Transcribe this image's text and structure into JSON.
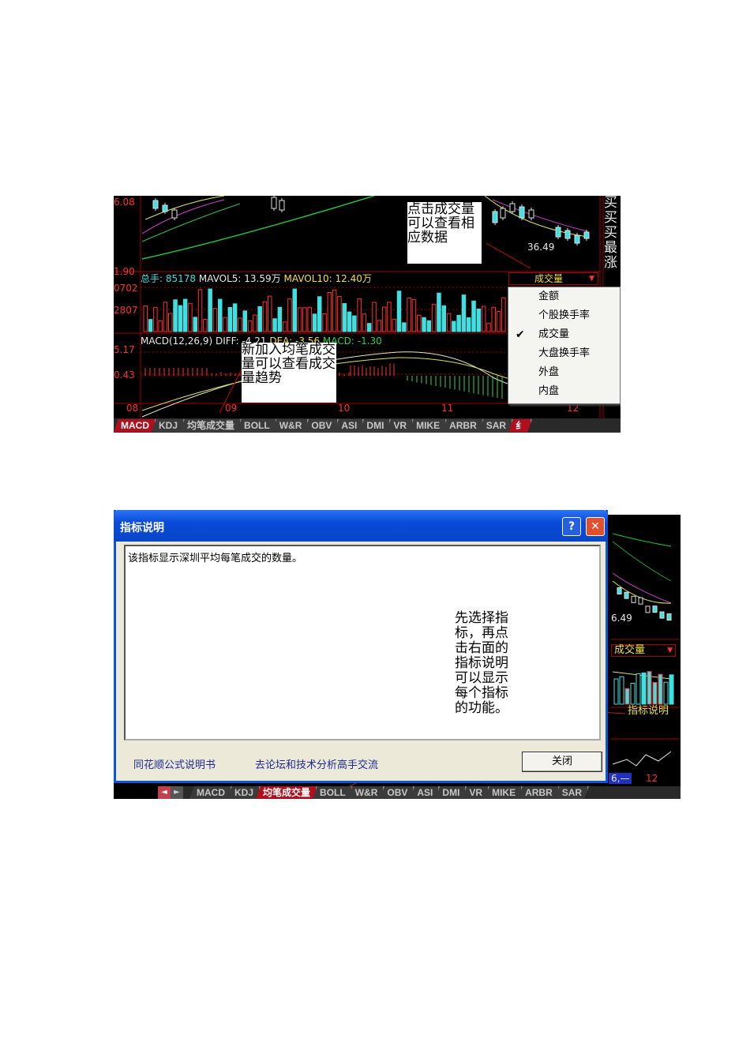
{
  "shot1": {
    "price_top_left": "6.08",
    "price_mid_left": "1.90",
    "vol_axis_1": "0702",
    "vol_axis_2": "2807",
    "macd_axis_1": "5.17",
    "macd_axis_2": "0.43",
    "price_label": "36.49",
    "right_panel_chars": [
      "买",
      "买",
      "买",
      "最",
      "涨"
    ],
    "vol_line": {
      "total": "总手: 85178",
      "mavol5": "MAVOL5: 13.59万",
      "mavol10": "MAVOL10: 12.40万"
    },
    "macd_line": {
      "params": "MACD(12,26,9)",
      "diff": "DIFF: -4.21",
      "dea": "DEA: -3.56",
      "macd": "MACD: -1.30"
    },
    "dates": [
      "08",
      "09",
      "10",
      "11",
      "12"
    ],
    "dropdown_label": "成交量",
    "menu_items": [
      {
        "label": "金额",
        "checked": false
      },
      {
        "label": "个股换手率",
        "checked": false
      },
      {
        "label": "成交量",
        "checked": true
      },
      {
        "label": "大盘换手率",
        "checked": false
      },
      {
        "label": "外盘",
        "checked": false
      },
      {
        "label": "内盘",
        "checked": false
      }
    ],
    "check_glyph": "✔",
    "note_top": "点击成交量可以查看相应数据",
    "note_bottom": "新加入均笔成交量可以查看成交量趋势",
    "tabs": [
      "MACD",
      "KDJ",
      "均笔成交量",
      "BOLL",
      "W&R",
      "OBV",
      "ASI",
      "DMI",
      "VR",
      "MIKE",
      "ARBR",
      "SAR"
    ],
    "tab_tail": "纟"
  },
  "shot2": {
    "dialog_title": "指标说明",
    "help_glyph": "?",
    "close_glyph": "✕",
    "description": "该指标显示深圳平均每笔成交的数量。",
    "link_manual": "同花顺公式说明书",
    "link_forum": "去论坛和技术分析高手交流",
    "close_button": "关闭",
    "note": "先选择指标，再点击右面的指标说明可以显示每个指标的功能。",
    "price_label": "6.49",
    "dropdown_label": "成交量",
    "indicator_help": "指标说明",
    "bottom_left_label": "6,—",
    "date_label": "12",
    "tabs": [
      "MACD",
      "KDJ",
      "均笔成交量",
      "BOLL",
      "W&R",
      "OBV",
      "ASI",
      "DMI",
      "VR",
      "MIKE",
      "ARBR",
      "SAR"
    ],
    "nav_left_glyph": "◄",
    "nav_right_glyph": "►"
  },
  "colors": {
    "chart_bg": "#000000",
    "grid_red": "#a00000",
    "volume_bar": "#40e0e0",
    "tab_active": "#b0101e",
    "dialog_blue": "#0a54e0"
  }
}
